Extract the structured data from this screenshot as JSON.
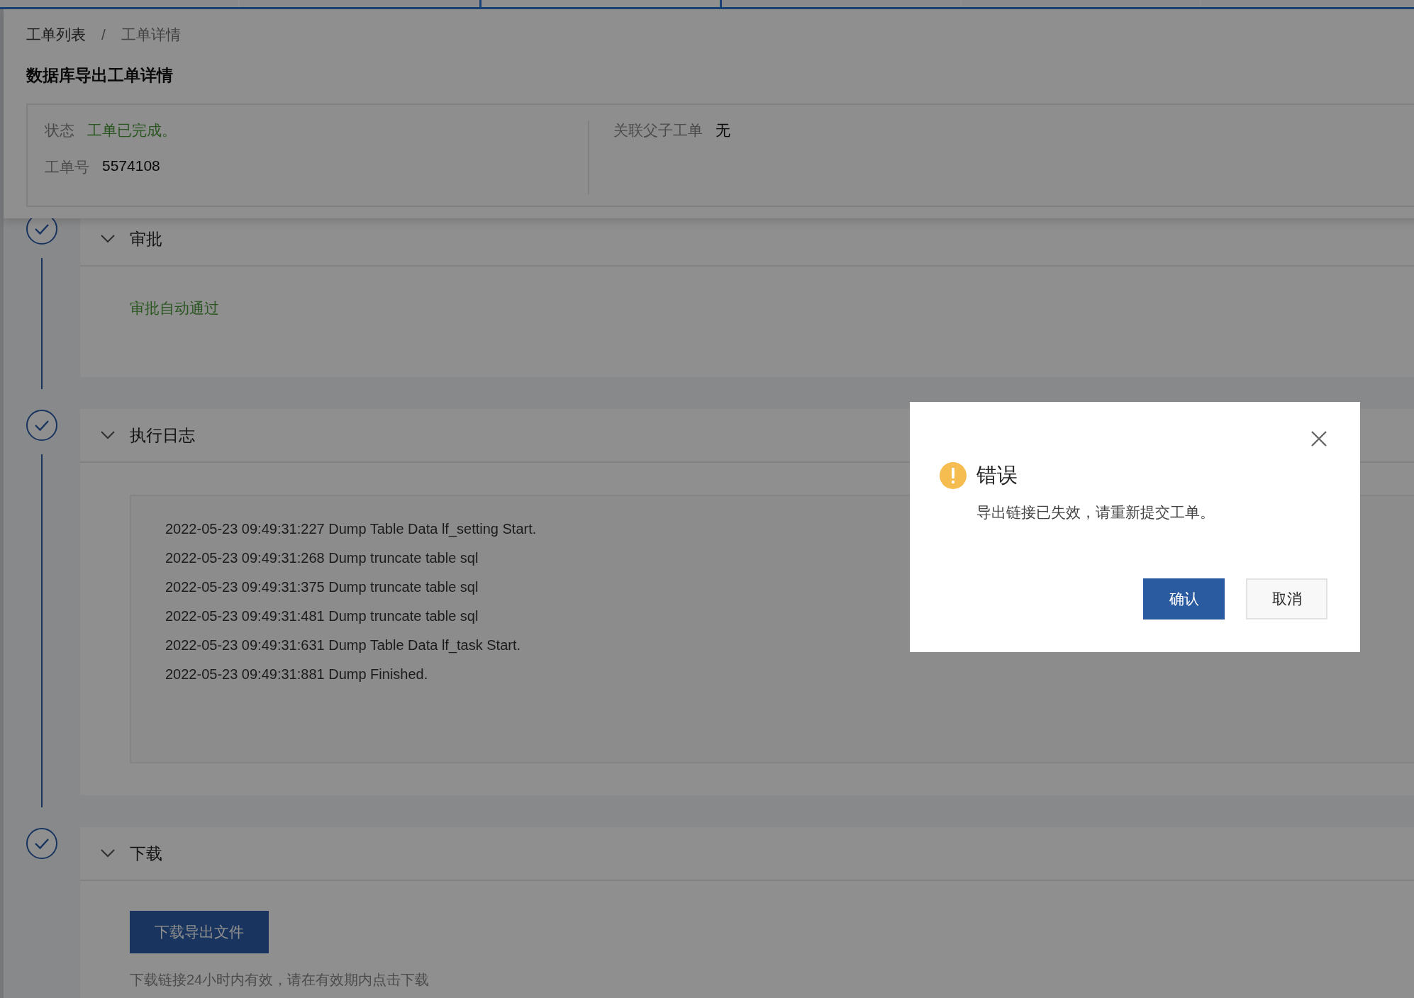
{
  "breadcrumb": [
    {
      "label": "工单列表"
    },
    {
      "label": "工单详情"
    }
  ],
  "breadcrumb_separator": "/",
  "title": "数据库导出工单详情",
  "info": {
    "left": [
      {
        "label": "状态",
        "value": "工单已完成。",
        "kind": "status"
      },
      {
        "label": "工单号",
        "value": "5574108",
        "kind": "plain"
      }
    ],
    "right": [
      {
        "label": "关联父子工单",
        "value": "无",
        "kind": "plain"
      }
    ]
  },
  "steps": [
    {
      "title": "审批",
      "expanded": true,
      "kind": "text",
      "text": "审批自动通过"
    },
    {
      "title": "执行日志",
      "expanded": true,
      "kind": "log",
      "lines": [
        "2022-05-23 09:49:31:227 Dump Table Data lf_setting Start.",
        "2022-05-23 09:49:31:268 Dump truncate table sql",
        "2022-05-23 09:49:31:375 Dump truncate table sql",
        "2022-05-23 09:49:31:481 Dump truncate table sql",
        "2022-05-23 09:49:31:631 Dump Table Data lf_task Start.",
        "2022-05-23 09:49:31:881 Dump Finished."
      ]
    },
    {
      "title": "下载",
      "expanded": true,
      "kind": "download",
      "button": "下载导出文件",
      "note": "下载链接24小时内有效，请在有效期内点击下载"
    }
  ],
  "dialog": {
    "title": "错误",
    "message": "导出链接已失效，请重新提交工单。",
    "buttons": [
      {
        "label": "确认",
        "kind": "primary"
      },
      {
        "label": "取消",
        "kind": "default"
      }
    ]
  }
}
